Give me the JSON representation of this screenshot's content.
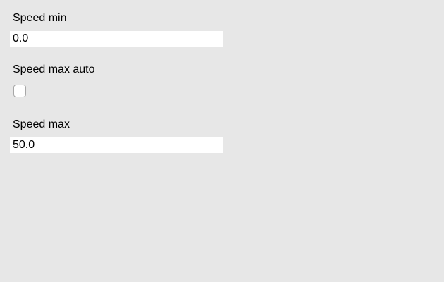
{
  "form": {
    "speed_min": {
      "label": "Speed min",
      "value": "0.0"
    },
    "speed_max_auto": {
      "label": "Speed max auto",
      "checked": false
    },
    "speed_max": {
      "label": "Speed max",
      "value": "50.0"
    }
  },
  "colors": {
    "background": "#e7e7e7",
    "field_background": "#ffffff",
    "checkbox_border": "#a7a7a7"
  }
}
